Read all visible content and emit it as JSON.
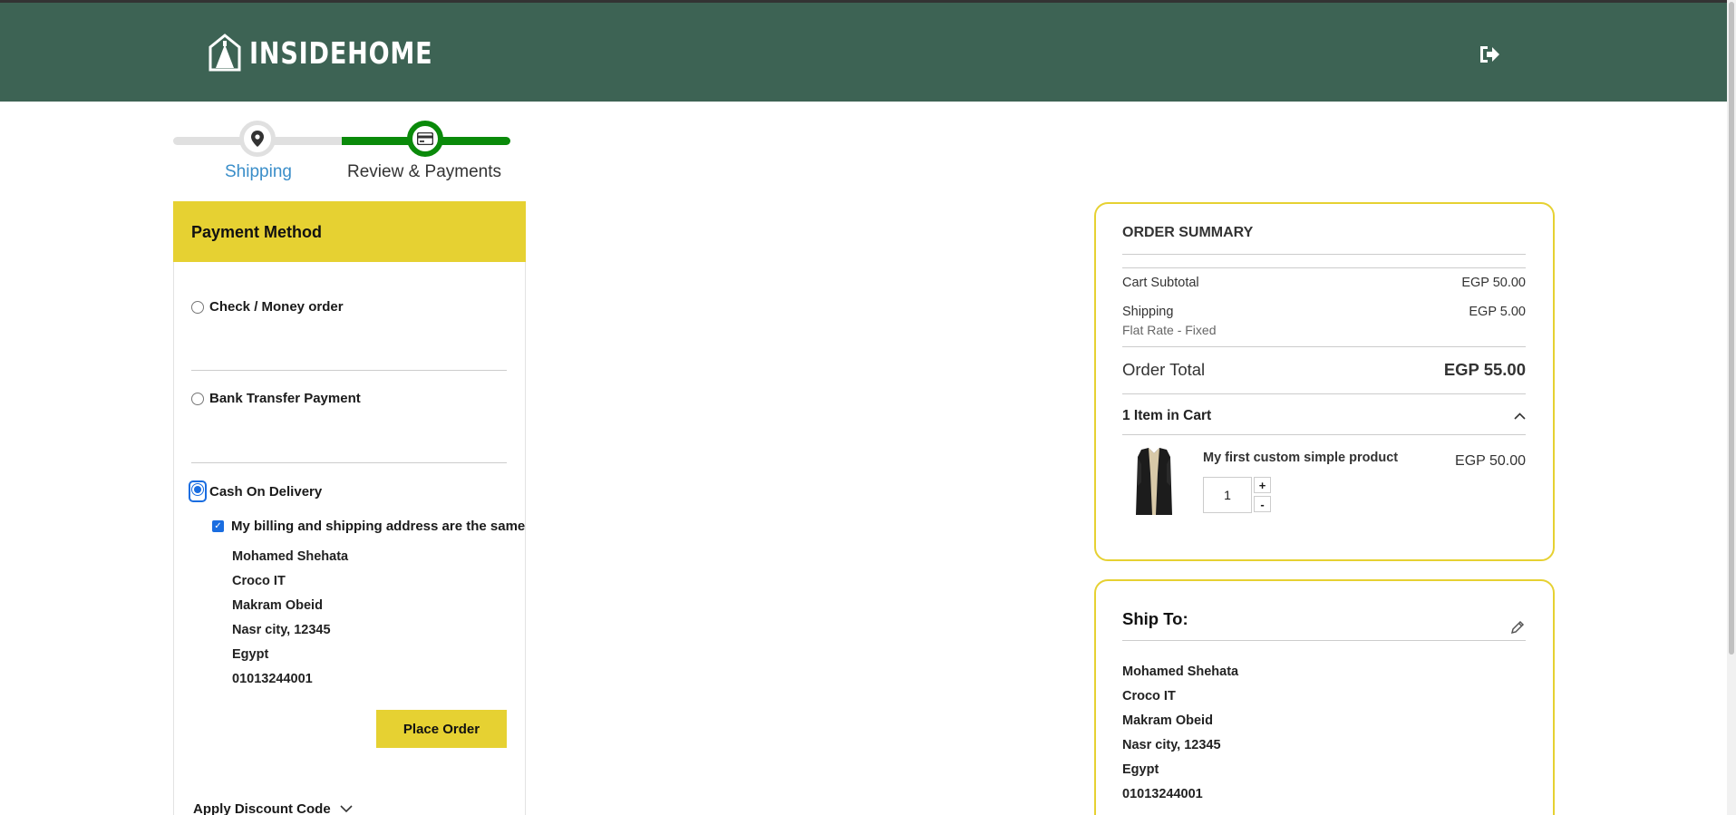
{
  "header": {
    "logo_text": "INSIDEHOME",
    "logout_icon": "sign-out-icon",
    "background": "#3d6354"
  },
  "progress": {
    "steps": [
      {
        "label": "Shipping",
        "icon": "map-pin-icon",
        "state": "done"
      },
      {
        "label": "Review & Payments",
        "icon": "credit-card-icon",
        "state": "active"
      }
    ],
    "active_color": "#0a8a0a"
  },
  "payment": {
    "title": "Payment Method",
    "options": [
      {
        "label": "Check / Money order",
        "selected": false
      },
      {
        "label": "Bank Transfer Payment",
        "selected": false
      },
      {
        "label": "Cash On Delivery",
        "selected": true
      }
    ],
    "same_address_label": "My billing and shipping address are the same",
    "same_address_checked": true,
    "billing_address": [
      "Mohamed Shehata",
      "Croco IT",
      "Makram Obeid",
      "Nasr city, 12345",
      "Egypt",
      "01013244001"
    ],
    "place_order_label": "Place Order",
    "discount_label": "Apply Discount Code",
    "accent": "#e6d132"
  },
  "summary": {
    "title": "ORDER SUMMARY",
    "cart_subtotal_label": "Cart Subtotal",
    "cart_subtotal": "EGP 50.00",
    "shipping_label": "Shipping",
    "shipping_method": "Flat Rate - Fixed",
    "shipping_amount": "EGP 5.00",
    "order_total_label": "Order Total",
    "order_total": "EGP 55.00",
    "items_label": "1 Item in Cart",
    "item": {
      "name": "My first custom simple product",
      "price": "EGP 50.00",
      "qty": "1",
      "plus": "+",
      "minus": "-"
    }
  },
  "shipto": {
    "title": "Ship To:",
    "address": [
      "Mohamed Shehata",
      "Croco IT",
      "Makram Obeid",
      "Nasr city, 12345",
      "Egypt",
      "01013244001"
    ]
  }
}
